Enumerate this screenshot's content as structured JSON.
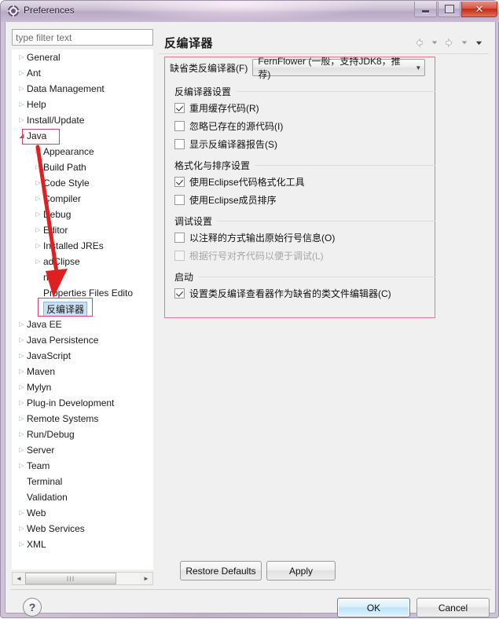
{
  "window": {
    "title": "Preferences",
    "app_icon": "gear-icon",
    "minimize_label": "Minimize",
    "maximize_label": "Maximize",
    "close_label": "✕"
  },
  "sidebar": {
    "filter_placeholder": "type filter text",
    "items": [
      {
        "label": "General",
        "level": 1,
        "twisty": "collapsed",
        "selected": false
      },
      {
        "label": "Ant",
        "level": 1,
        "twisty": "collapsed",
        "selected": false
      },
      {
        "label": "Data Management",
        "level": 1,
        "twisty": "collapsed",
        "selected": false
      },
      {
        "label": "Help",
        "level": 1,
        "twisty": "collapsed",
        "selected": false
      },
      {
        "label": "Install/Update",
        "level": 1,
        "twisty": "collapsed",
        "selected": false
      },
      {
        "label": "Java",
        "level": 1,
        "twisty": "expanded",
        "selected": false
      },
      {
        "label": "Appearance",
        "level": 2,
        "twisty": "collapsed",
        "selected": false
      },
      {
        "label": "Build Path",
        "level": 2,
        "twisty": "collapsed",
        "selected": false
      },
      {
        "label": "Code Style",
        "level": 2,
        "twisty": "collapsed",
        "selected": false
      },
      {
        "label": "Compiler",
        "level": 2,
        "twisty": "collapsed",
        "selected": false
      },
      {
        "label": "Debug",
        "level": 2,
        "twisty": "collapsed",
        "selected": false
      },
      {
        "label": "Editor",
        "level": 2,
        "twisty": "collapsed",
        "selected": false
      },
      {
        "label": "Installed JREs",
        "level": 2,
        "twisty": "collapsed",
        "selected": false
      },
      {
        "label": "adClipse",
        "level": 2,
        "twisty": "collapsed",
        "selected": false
      },
      {
        "label": "nit",
        "level": 2,
        "twisty": "none",
        "selected": false
      },
      {
        "label": "Properties Files Edito",
        "level": 2,
        "twisty": "none",
        "selected": false
      },
      {
        "label": "反编译器",
        "level": 2,
        "twisty": "none",
        "selected": true
      },
      {
        "label": "Java EE",
        "level": 1,
        "twisty": "collapsed",
        "selected": false
      },
      {
        "label": "Java Persistence",
        "level": 1,
        "twisty": "collapsed",
        "selected": false
      },
      {
        "label": "JavaScript",
        "level": 1,
        "twisty": "collapsed",
        "selected": false
      },
      {
        "label": "Maven",
        "level": 1,
        "twisty": "collapsed",
        "selected": false
      },
      {
        "label": "Mylyn",
        "level": 1,
        "twisty": "collapsed",
        "selected": false
      },
      {
        "label": "Plug-in Development",
        "level": 1,
        "twisty": "collapsed",
        "selected": false
      },
      {
        "label": "Remote Systems",
        "level": 1,
        "twisty": "collapsed",
        "selected": false
      },
      {
        "label": "Run/Debug",
        "level": 1,
        "twisty": "collapsed",
        "selected": false
      },
      {
        "label": "Server",
        "level": 1,
        "twisty": "collapsed",
        "selected": false
      },
      {
        "label": "Team",
        "level": 1,
        "twisty": "collapsed",
        "selected": false
      },
      {
        "label": "Terminal",
        "level": 1,
        "twisty": "none",
        "selected": false
      },
      {
        "label": "Validation",
        "level": 1,
        "twisty": "none",
        "selected": false
      },
      {
        "label": "Web",
        "level": 1,
        "twisty": "collapsed",
        "selected": false
      },
      {
        "label": "Web Services",
        "level": 1,
        "twisty": "collapsed",
        "selected": false
      },
      {
        "label": "XML",
        "level": 1,
        "twisty": "collapsed",
        "selected": false
      }
    ],
    "scrollbar": {
      "left_arrow": "◄",
      "right_arrow": "►",
      "thumb_grip": "III"
    }
  },
  "main": {
    "page_title": "反编译器",
    "nav_icons": [
      "back-arrow-icon",
      "back-dropdown-icon",
      "forward-arrow-icon",
      "forward-dropdown-icon",
      "menu-dropdown-icon"
    ],
    "combo": {
      "label": "缺省类反编译器(F)",
      "value": "FernFlower (一般，支持JDK8，推荐)",
      "caret": "▼"
    },
    "groups": [
      {
        "title": "反编译器设置",
        "options": [
          {
            "label": "重用缓存代码(R)",
            "checked": true,
            "disabled": false
          },
          {
            "label": "忽略已存在的源代码(I)",
            "checked": false,
            "disabled": false
          },
          {
            "label": "显示反编译器报告(S)",
            "checked": false,
            "disabled": false
          }
        ]
      },
      {
        "title": "格式化与排序设置",
        "options": [
          {
            "label": "使用Eclipse代码格式化工具",
            "checked": true,
            "disabled": false
          },
          {
            "label": "使用Eclipse成员排序",
            "checked": false,
            "disabled": false
          }
        ]
      },
      {
        "title": "调试设置",
        "options": [
          {
            "label": "以注释的方式输出原始行号信息(O)",
            "checked": false,
            "disabled": false
          },
          {
            "label": "根据行号对齐代码以便于调试(L)",
            "checked": false,
            "disabled": true
          }
        ]
      },
      {
        "title": "启动",
        "options": [
          {
            "label": "设置类反编译查看器作为缺省的类文件编辑器(C)",
            "checked": true,
            "disabled": false
          }
        ]
      }
    ]
  },
  "footer": {
    "restore_defaults": "Restore Defaults",
    "apply": "Apply",
    "ok": "OK",
    "cancel": "Cancel",
    "help": "?"
  },
  "annotations": {
    "accent_color": "#d7426a",
    "arrow_color": "#e02020",
    "highlight_boxes": [
      "Java",
      "反编译器",
      "settings-panel"
    ]
  }
}
